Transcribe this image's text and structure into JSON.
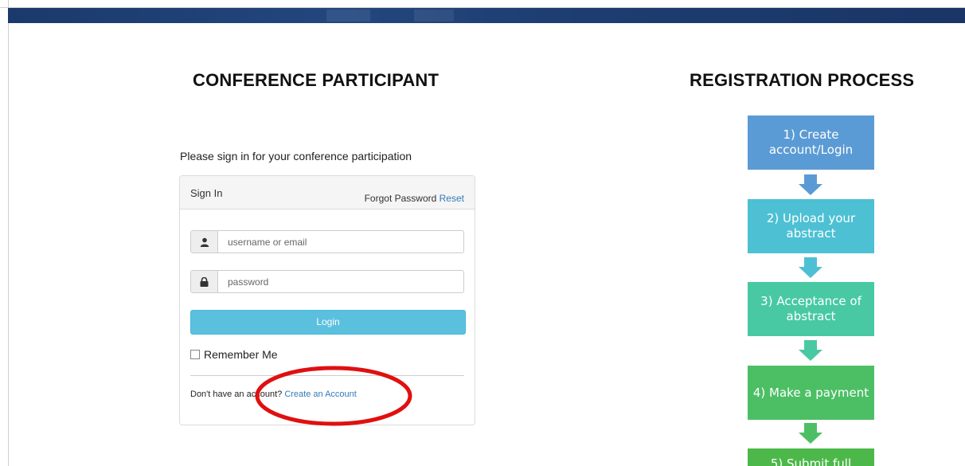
{
  "headings": {
    "left": "CONFERENCE PARTICIPANT",
    "right": "REGISTRATION PROCESS"
  },
  "intro_text": "Please sign in for your conference participation",
  "signin": {
    "title": "Sign In",
    "forgot_label": "Forgot Password",
    "reset_link": "Reset",
    "username_placeholder": "username or email",
    "password_placeholder": "password",
    "login_button": "Login",
    "remember_label": "Remember Me",
    "no_account_text": "Don't have an account?",
    "create_account_link": "Create an Account"
  },
  "process_steps": [
    {
      "label": "1) Create account/Login",
      "color": "#5b9bd5"
    },
    {
      "label": "2) Upload your abstract",
      "color": "#4dc0d4"
    },
    {
      "label": "3) Acceptance of abstract",
      "color": "#48c9a4"
    },
    {
      "label": "4) Make a payment",
      "color": "#4cbf65"
    },
    {
      "label": "5) Submit full",
      "color": "#4db84a"
    }
  ],
  "arrow_colors": [
    "#5b9bd5",
    "#4dc0d4",
    "#48c9a4",
    "#4cbf65"
  ],
  "highlight_color": "#e01010"
}
